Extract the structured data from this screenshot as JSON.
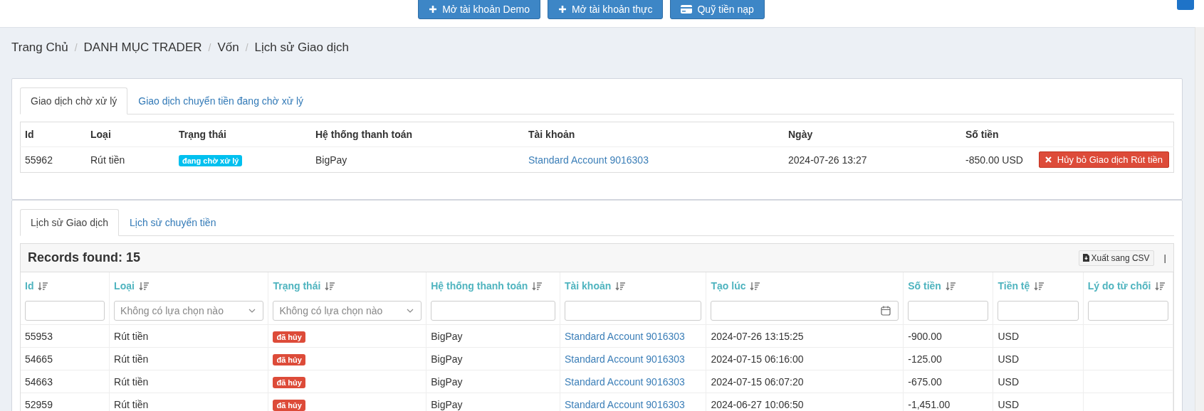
{
  "top_buttons": [
    {
      "label": "Mở tài khoản Demo",
      "kind": "plus"
    },
    {
      "label": "Mở tài khoản thực",
      "kind": "plus"
    },
    {
      "label": "Quỹ tiền nạp",
      "kind": "card"
    }
  ],
  "breadcrumb": [
    "Trang Chủ",
    "DANH MỤC TRADER",
    "Vốn",
    "Lịch sử Giao dịch"
  ],
  "breadcrumb_separator": "/",
  "pending_panel": {
    "tabs": [
      {
        "label": "Giao dịch chờ xử lý",
        "selected": true
      },
      {
        "label": "Giao dịch chuyển tiền đang chờ xử lý",
        "selected": false
      }
    ],
    "columns": [
      "Id",
      "Loại",
      "Trạng thái",
      "Hệ thống thanh toán",
      "Tài khoản",
      "Ngày",
      "Số tiền"
    ],
    "rows": [
      {
        "id": "55962",
        "type": "Rút tiền",
        "status": {
          "text": "đang chờ xử lý",
          "kind": "pending"
        },
        "system": "BigPay",
        "account": "Standard Account 9016303",
        "date": "2024-07-26 13:27",
        "amount": "-850.00 USD",
        "action": "Hủy bỏ Giao dịch Rút tiền"
      }
    ]
  },
  "history_panel": {
    "tabs": [
      {
        "label": "Lịch sử Giao dịch",
        "selected": true
      },
      {
        "label": "Lịch sử chuyển tiền",
        "selected": false
      }
    ],
    "records_found": "Records found: 15",
    "export_button": "Xuất sang CSV",
    "separator": "|",
    "columns": [
      {
        "label": "Id",
        "kind": "text"
      },
      {
        "label": "Loại",
        "kind": "select",
        "placeholder": "Không có lựa chọn nào"
      },
      {
        "label": "Trạng thái",
        "kind": "select",
        "placeholder": "Không có lựa chọn nào"
      },
      {
        "label": "Hệ thống thanh toán",
        "kind": "text"
      },
      {
        "label": "Tài khoản",
        "kind": "text"
      },
      {
        "label": "Tạo lúc",
        "kind": "date"
      },
      {
        "label": "Số tiền",
        "kind": "text"
      },
      {
        "label": "Tiền tệ",
        "kind": "text"
      },
      {
        "label": "Lý do từ chối",
        "kind": "text"
      }
    ],
    "rows": [
      {
        "id": "55953",
        "type": "Rút tiền",
        "status": {
          "text": "đã hủy",
          "kind": "cancelled"
        },
        "system": "BigPay",
        "account": "Standard Account 9016303",
        "created": "2024-07-26 13:15:25",
        "amount": "-900.00",
        "currency": "USD"
      },
      {
        "id": "54665",
        "type": "Rút tiền",
        "status": {
          "text": "đã hủy",
          "kind": "cancelled"
        },
        "system": "BigPay",
        "account": "Standard Account 9016303",
        "created": "2024-07-15 06:16:00",
        "amount": "-125.00",
        "currency": "USD"
      },
      {
        "id": "54663",
        "type": "Rút tiền",
        "status": {
          "text": "đã hủy",
          "kind": "cancelled"
        },
        "system": "BigPay",
        "account": "Standard Account 9016303",
        "created": "2024-07-15 06:07:20",
        "amount": "-675.00",
        "currency": "USD"
      },
      {
        "id": "52959",
        "type": "Rút tiền",
        "status": {
          "text": "đã hủy",
          "kind": "cancelled"
        },
        "system": "BigPay",
        "account": "Standard Account 9016303",
        "created": "2024-06-27 10:06:50",
        "amount": "-1,451.00",
        "currency": "USD"
      }
    ]
  }
}
